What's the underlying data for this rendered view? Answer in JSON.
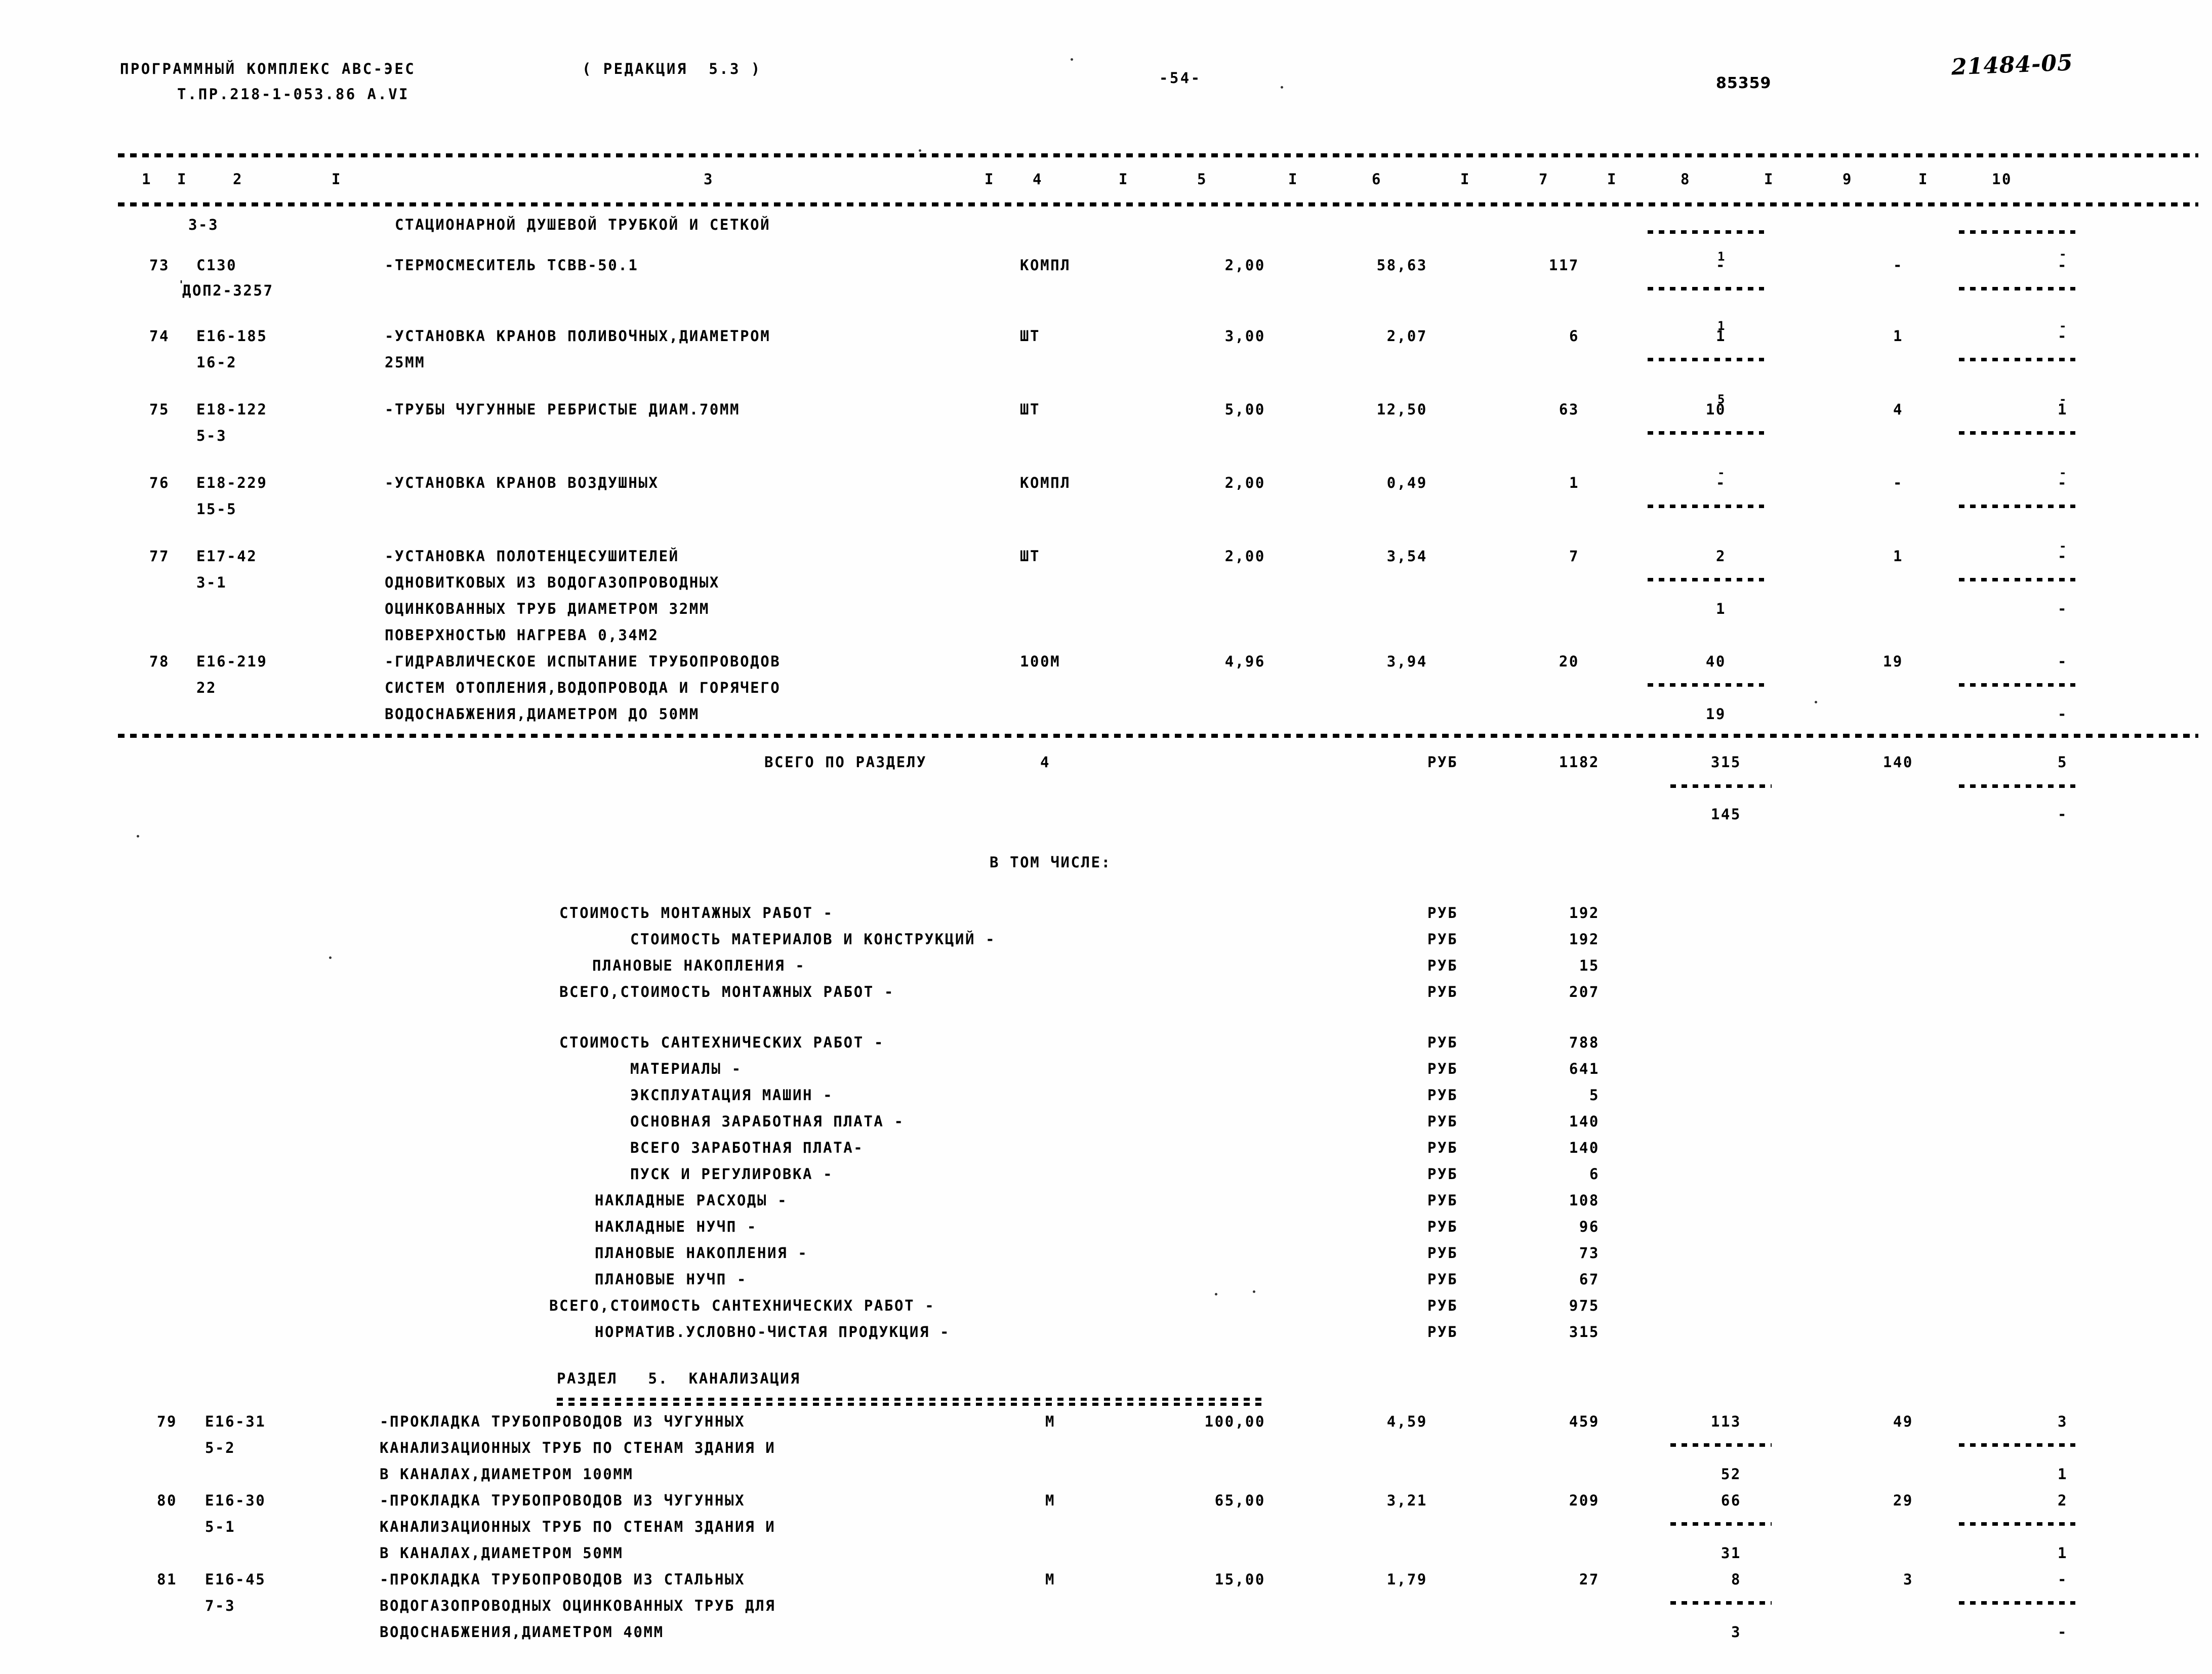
{
  "header": {
    "program_line1": "ПРОГРАММНЫЙ КОМПЛЕКС АВС-ЭЕС",
    "program_line2": "Т.ПР.218-1-053.86 А.VI",
    "revision": "( РЕДАКЦИЯ  5.3 )",
    "page_number": "-54-",
    "stamp_number": "85359",
    "handwritten_code": "21484-05"
  },
  "columns": [
    "1",
    "2",
    "3",
    "4",
    "5",
    "6",
    "7",
    "8",
    "9",
    "10"
  ],
  "section3_label": "3-3",
  "section3_title": "СТАЦИОНАРНОЙ ДУШЕВОЙ ТРУБКОЙ И СЕТКОЙ",
  "rows": [
    {
      "num": "73",
      "code": "С130",
      "code2": "ДОП2-3257",
      "desc": [
        "-ТЕРМОСМЕСИТЕЛЬ ТСВВ-50.1"
      ],
      "unit": "КОМПЛ",
      "qty": "2,00",
      "price": "58,63",
      "total": "117",
      "c8": "-",
      "c8b": "1",
      "c9": "-",
      "c10": "-",
      "c10b": "-"
    },
    {
      "num": "74",
      "code": "Е16-185",
      "code2": "16-2",
      "desc": [
        "-УСТАНОВКА КРАНОВ ПОЛИВОЧНЫХ,ДИАМЕТРОМ",
        "25ММ"
      ],
      "unit": "ШТ",
      "qty": "3,00",
      "price": "2,07",
      "total": "6",
      "c8": "1",
      "c8b": "1",
      "c9": "1",
      "c10": "-",
      "c10b": "-"
    },
    {
      "num": "75",
      "code": "Е18-122",
      "code2": "5-3",
      "desc": [
        "-ТРУБЫ ЧУГУННЫЕ РЕБРИСТЫЕ ДИАМ.70ММ"
      ],
      "unit": "ШТ",
      "qty": "5,00",
      "price": "12,50",
      "total": "63",
      "c8": "10",
      "c8b": "5",
      "c9": "4",
      "c10": "1",
      "c10b": "-"
    },
    {
      "num": "76",
      "code": "Е18-229",
      "code2": "15-5",
      "desc": [
        "-УСТАНОВКА КРАНОВ ВОЗДУШНЫХ"
      ],
      "unit": "КОМПЛ",
      "qty": "2,00",
      "price": "0,49",
      "total": "1",
      "c8": "-",
      "c8b": "-",
      "c9": "-",
      "c10": "-",
      "c10b": "-"
    },
    {
      "num": "77",
      "code": "Е17-42",
      "code2": "3-1",
      "desc": [
        "-УСТАНОВКА ПОЛОТЕНЦЕСУШИТЕЛЕЙ",
        "ОДНОВИТКОВЫХ ИЗ ВОДОГАЗОПРОВОДНЫХ",
        "ОЦИНКОВАННЫХ ТРУБ ДИАМЕТРОМ 32ММ",
        "ПОВЕРХНОСТЬЮ НАГРЕВА 0,34М2"
      ],
      "unit": "ШТ",
      "qty": "2,00",
      "price": "3,54",
      "total": "7",
      "c8": "2",
      "c8b": "1",
      "c9": "1",
      "c10": "-",
      "c10b": "-"
    },
    {
      "num": "78",
      "code": "Е16-219",
      "code2": "22",
      "desc": [
        "-ГИДРАВЛИЧЕСКОЕ ИСПЫТАНИЕ ТРУБОПРОВОДОВ",
        "СИСТЕМ ОТОПЛЕНИЯ,ВОДОПРОВОДА И ГОРЯЧЕГО",
        "ВОДОСНАБЖЕНИЯ,ДИАМЕТРОМ ДО 50ММ"
      ],
      "unit": "100М",
      "qty": "4,96",
      "price": "3,94",
      "total": "20",
      "c8": "40",
      "c8b": "19",
      "c9": "19",
      "c10": "-",
      "c10b": "-"
    }
  ],
  "section_total": {
    "label": "ВСЕГО ПО РАЗДЕЛУ",
    "number": "4",
    "unit": "РУБ",
    "c7": "1182",
    "c8": "315",
    "c8b": "145",
    "c9": "140",
    "c10": "5",
    "c10b": "-"
  },
  "in_which_label": "В ТОМ ЧИСЛЕ:",
  "breakdown_group1": [
    {
      "label": "СТОИМОСТЬ МОНТАЖНЫХ РАБОТ -",
      "indent": 0,
      "unit": "РУБ",
      "value": "192"
    },
    {
      "label": "СТОИМОСТЬ МАТЕРИАЛОВ И КОНСТРУКЦИЙ -",
      "indent": 1,
      "unit": "РУБ",
      "value": "192"
    },
    {
      "label": "ПЛАНОВЫЕ НАКОПЛЕНИЯ -",
      "indent": 1,
      "unit": "РУБ",
      "value": "15"
    },
    {
      "label": "ВСЕГО,СТОИМОСТЬ МОНТАЖНЫХ РАБОТ -",
      "indent": 0,
      "unit": "РУБ",
      "value": "207"
    }
  ],
  "breakdown_group2": [
    {
      "label": "СТОИМОСТЬ САНТЕХНИЧЕСКИХ РАБОТ -",
      "indent": 0,
      "unit": "РУБ",
      "value": "788"
    },
    {
      "label": "МАТЕРИАЛЫ -",
      "indent": 1,
      "unit": "РУБ",
      "value": "641"
    },
    {
      "label": "ЭКСПЛУАТАЦИЯ МАШИН -",
      "indent": 1,
      "unit": "РУБ",
      "value": "5"
    },
    {
      "label": "ОСНОВНАЯ ЗАРАБОТНАЯ ПЛАТА -",
      "indent": 1,
      "unit": "РУБ",
      "value": "140"
    },
    {
      "label": "ВСЕГО ЗАРАБОТНАЯ ПЛАТА-",
      "indent": 1,
      "unit": "РУБ",
      "value": "140"
    },
    {
      "label": "ПУСК И РЕГУЛИРОВКА -",
      "indent": 1,
      "unit": "РУБ",
      "value": "6"
    },
    {
      "label": "НАКЛАДНЫЕ РАСХОДЫ -",
      "indent": 0,
      "unit": "РУБ",
      "value": "108"
    },
    {
      "label": "НАКЛАДНЫЕ НУЧП -",
      "indent": 0,
      "unit": "РУБ",
      "value": "96"
    },
    {
      "label": "ПЛАНОВЫЕ НАКОПЛЕНИЯ -",
      "indent": 0,
      "unit": "РУБ",
      "value": "73"
    },
    {
      "label": "ПЛАНОВЫЕ НУЧП -",
      "indent": 0,
      "unit": "РУБ",
      "value": "67"
    },
    {
      "label": "ВСЕГО,СТОИМОСТЬ САНТЕХНИЧЕСКИХ РАБОТ -",
      "indent": -1,
      "unit": "РУБ",
      "value": "975"
    },
    {
      "label": "НОРМАТИВ.УСЛОВНО-ЧИСТАЯ ПРОДУКЦИЯ -",
      "indent": 0,
      "unit": "РУБ",
      "value": "315"
    }
  ],
  "section5_title": "РАЗДЕЛ   5.  КАНАЛИЗАЦИЯ",
  "rows2": [
    {
      "num": "79",
      "code": "Е16-31",
      "code2": "5-2",
      "desc": [
        "-ПРОКЛАДКА ТРУБОПРОВОДОВ ИЗ ЧУГУННЫХ",
        "КАНАЛИЗАЦИОННЫХ ТРУБ ПО СТЕНАМ ЗДАНИЯ И",
        "В КАНАЛАХ,ДИАМЕТРОМ 100ММ"
      ],
      "unit": "М",
      "qty": "100,00",
      "price": "4,59",
      "total": "459",
      "c8": "113",
      "c8b": "52",
      "c9": "49",
      "c10": "3",
      "c10b": "1"
    },
    {
      "num": "80",
      "code": "Е16-30",
      "code2": "5-1",
      "desc": [
        "-ПРОКЛАДКА ТРУБОПРОВОДОВ ИЗ ЧУГУННЫХ",
        "КАНАЛИЗАЦИОННЫХ ТРУБ ПО СТЕНАМ ЗДАНИЯ И",
        "В КАНАЛАХ,ДИАМЕТРОМ 50ММ"
      ],
      "unit": "М",
      "qty": "65,00",
      "price": "3,21",
      "total": "209",
      "c8": "66",
      "c8b": "31",
      "c9": "29",
      "c10": "2",
      "c10b": "1"
    },
    {
      "num": "81",
      "code": "Е16-45",
      "code2": "7-3",
      "desc": [
        "-ПРОКЛАДКА ТРУБОПРОВОДОВ ИЗ СТАЛЬНЫХ",
        "ВОДОГАЗОПРОВОДНЫХ ОЦИНКОВАННЫХ ТРУБ ДЛЯ",
        "ВОДОСНАБЖЕНИЯ,ДИАМЕТРОМ 40ММ"
      ],
      "unit": "М",
      "qty": "15,00",
      "price": "1,79",
      "total": "27",
      "c8": "8",
      "c8b": "3",
      "c9": "3",
      "c10": "-",
      "c10b": "-"
    }
  ]
}
